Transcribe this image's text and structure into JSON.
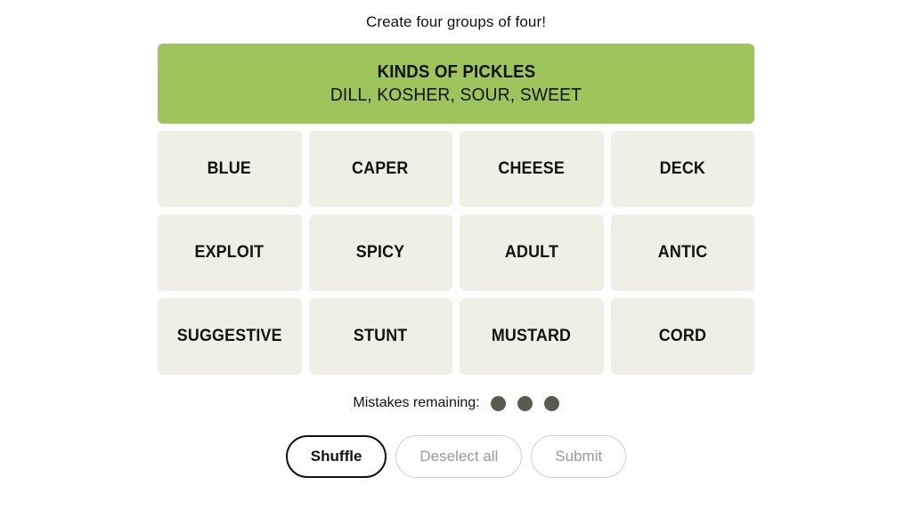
{
  "header": {
    "instruction": "Create four groups of four!"
  },
  "board": {
    "solved_groups": [
      {
        "title": "KINDS OF PICKLES",
        "members": "DILL, KOSHER, SOUR, SWEET",
        "color": "#9ec45c"
      }
    ],
    "tile_bg": "#efefe6",
    "rows": [
      [
        "BLUE",
        "CAPER",
        "CHEESE",
        "DECK"
      ],
      [
        "EXPLOIT",
        "SPICY",
        "ADULT",
        "ANTIC"
      ],
      [
        "SUGGESTIVE",
        "STUNT",
        "MUSTARD",
        "CORD"
      ]
    ]
  },
  "mistakes": {
    "label": "Mistakes remaining:",
    "remaining": 3,
    "dot_color": "#5a5a4e"
  },
  "controls": {
    "shuffle": "Shuffle",
    "deselect_all": "Deselect all",
    "submit": "Submit"
  }
}
